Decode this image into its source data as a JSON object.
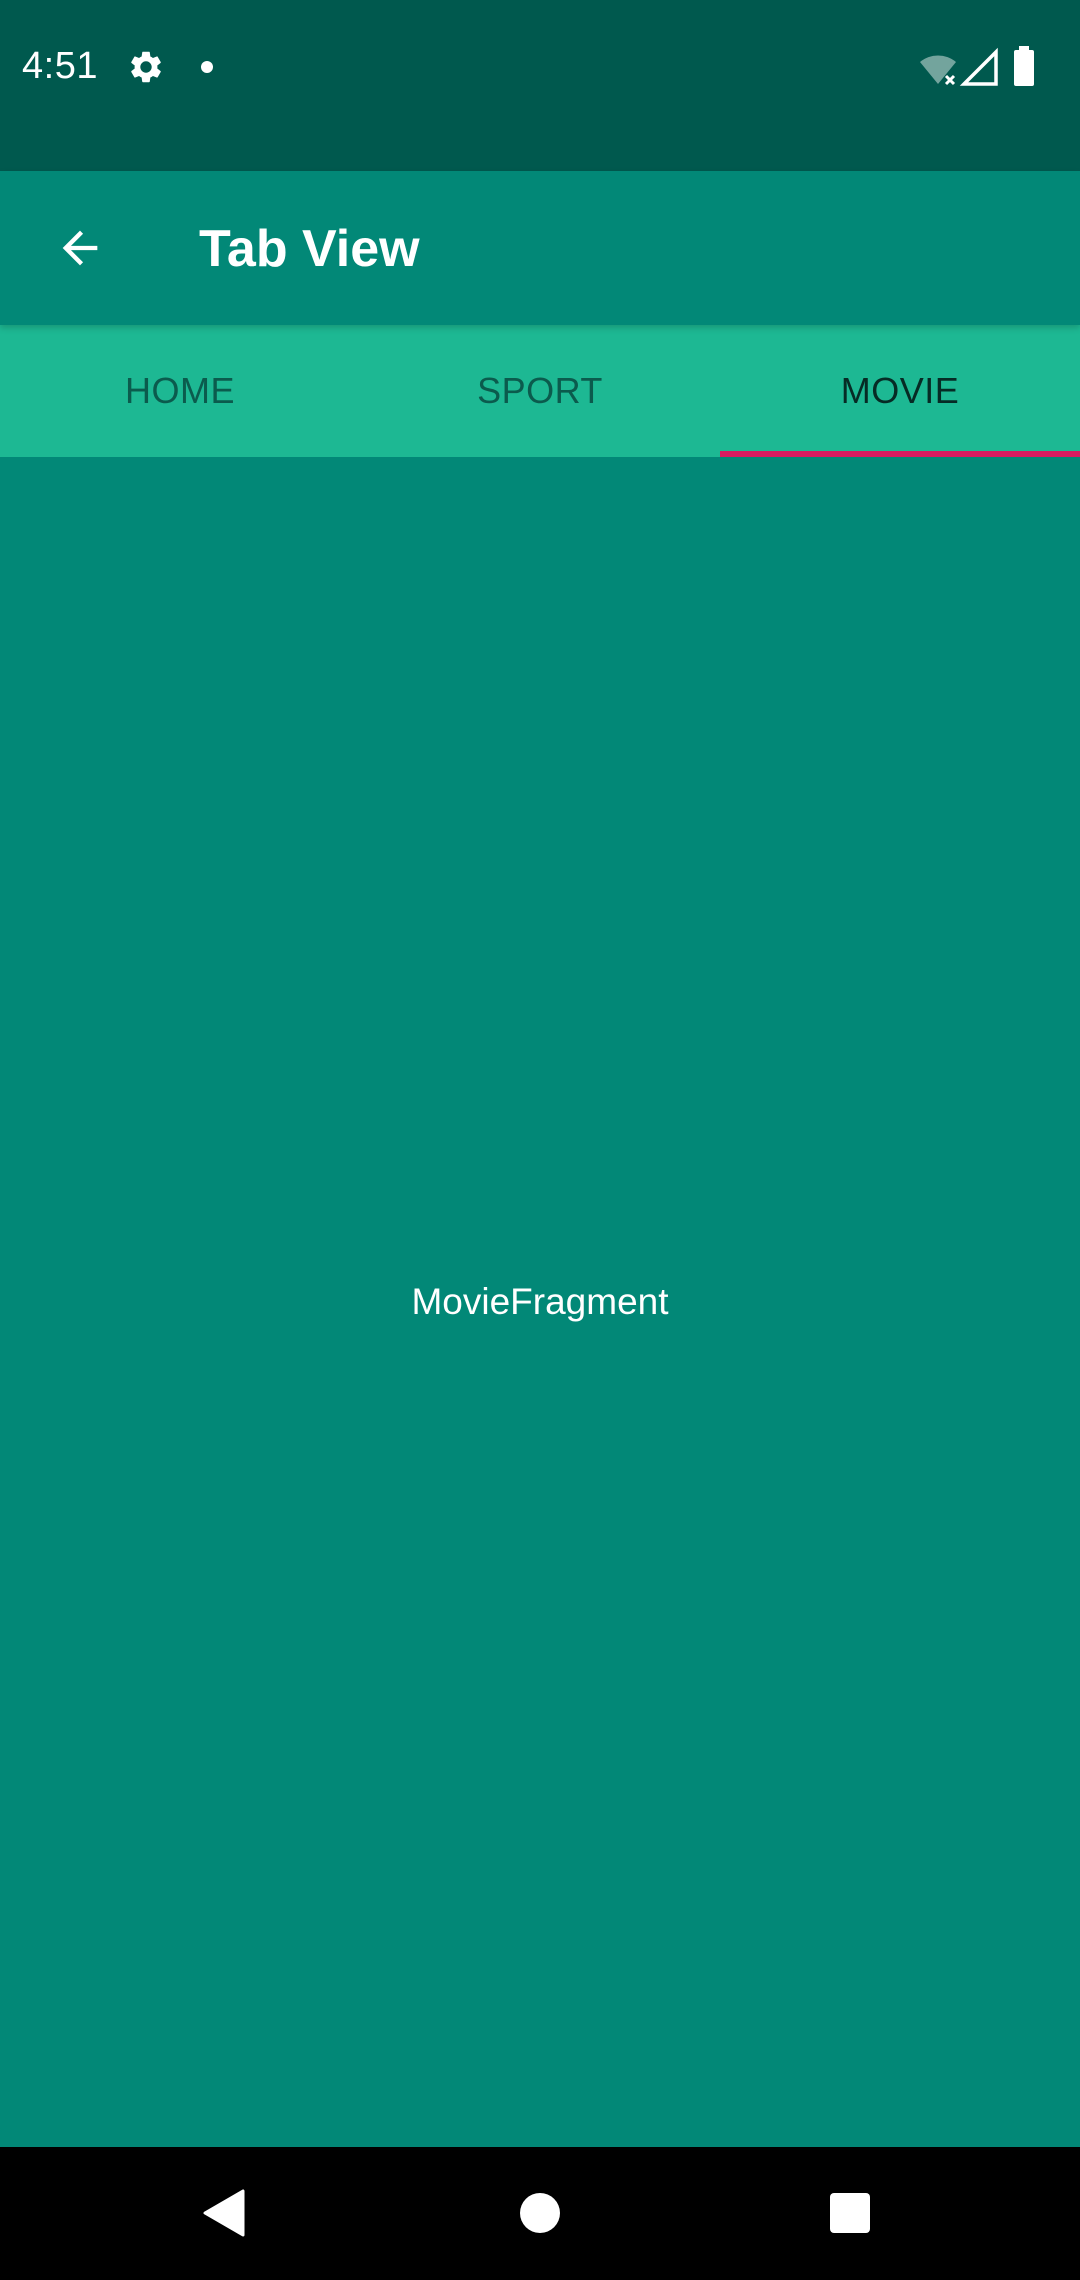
{
  "status_bar": {
    "time": "4:51",
    "icons": [
      "gear-icon",
      "notification-dot-icon",
      "wifi-off-icon",
      "signal-icon",
      "battery-icon"
    ]
  },
  "app_bar": {
    "title": "Tab View",
    "back_icon": "arrow-back-icon"
  },
  "tabs": [
    {
      "label": "HOME",
      "selected": false
    },
    {
      "label": "SPORT",
      "selected": false
    },
    {
      "label": "MOVIE",
      "selected": true
    }
  ],
  "content": {
    "label": "MovieFragment"
  },
  "nav_bar": {
    "icons": [
      "back-triangle-icon",
      "home-circle-icon",
      "recents-square-icon"
    ]
  },
  "colors": {
    "status_bar": "#00594e",
    "primary": "#028877",
    "tab_bar": "#1db893",
    "tab_indicator": "#d81b60",
    "tab_selected_text": "#062b25",
    "tab_unselected_text": "#0b5b4d"
  }
}
